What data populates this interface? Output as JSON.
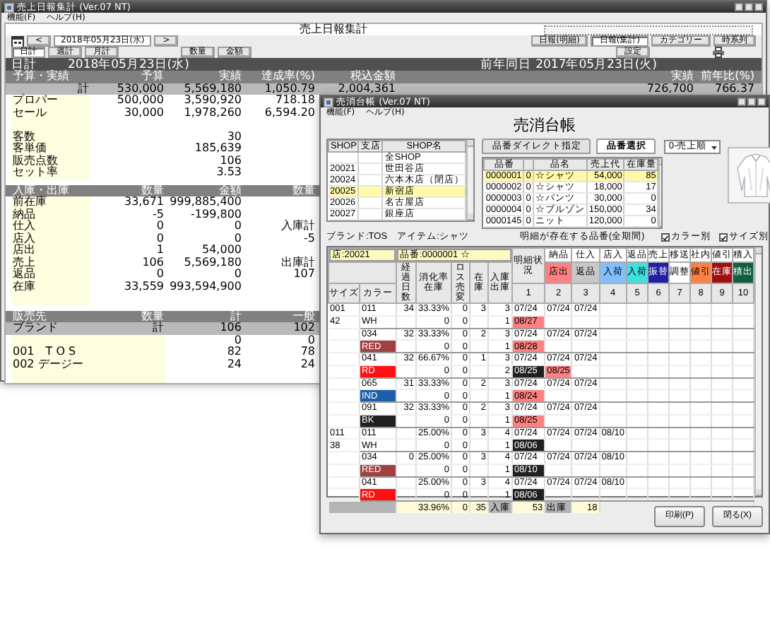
{
  "back_window": {
    "title": "売上日報集計 (Ver.07 NT)",
    "menu": [
      "機能(F)",
      "ヘルプ(H)"
    ],
    "heading": "売上日報集計",
    "date_field": "2018年05月23日(水)",
    "nav_prev": "<",
    "nav_next": ">",
    "view_tabs": [
      {
        "label": "日計",
        "selected": true
      },
      {
        "label": "週計",
        "selected": false
      },
      {
        "label": "月計",
        "selected": false
      }
    ],
    "unit_buttons": [
      "数量",
      "金額"
    ],
    "report_buttons": [
      {
        "label": "日報(明細)",
        "selected": false
      },
      {
        "label": "日報(集計)",
        "selected": true
      },
      {
        "label": "カテゴリー",
        "selected": false
      },
      {
        "label": "時系列",
        "selected": false
      }
    ],
    "settings_button": "設定",
    "date_bar": {
      "label": "日計",
      "date": "2018年05月23日(水)",
      "prev_label": "前年同日",
      "prev_date": "2017年05月23日(火)"
    },
    "sections": [
      {
        "kind": "summary",
        "columns": [
          "予算・実績",
          "予算",
          "実績",
          "達成率(%)",
          "税込金額",
          null,
          "実績",
          "前年比(%)"
        ],
        "rows": [
          {
            "kind": "total",
            "cells": [
              "計",
              "530,000",
              "5,569,180",
              "1,050.79",
              "2,004,361",
              null,
              "726,700",
              "766.37"
            ]
          },
          {
            "kind": "item",
            "cells": [
              "プロパー",
              "500,000",
              "3,590,920",
              "718.18"
            ]
          },
          {
            "kind": "item",
            "cells": [
              "セール",
              "30,000",
              "1,978,260",
              "6,594.20"
            ]
          },
          {
            "kind": "gap",
            "cells": []
          },
          {
            "kind": "item",
            "cells": [
              "客数",
              null,
              "30"
            ]
          },
          {
            "kind": "item",
            "cells": [
              "客単価",
              null,
              "185,639"
            ]
          },
          {
            "kind": "item",
            "cells": [
              "販売点数",
              null,
              "106"
            ]
          },
          {
            "kind": "item",
            "cells": [
              "セット率",
              null,
              "3.53"
            ]
          }
        ]
      },
      {
        "kind": "summary",
        "columns": [
          "入庫・出庫",
          "数量",
          "金額",
          "数量"
        ],
        "rows": [
          {
            "kind": "item",
            "cells": [
              "前在庫",
              "33,671",
              "999,885,400"
            ]
          },
          {
            "kind": "item",
            "cells": [
              "納品",
              "-5",
              "-199,800"
            ]
          },
          {
            "kind": "item",
            "cells": [
              "仕入",
              "0",
              "0",
              "入庫計"
            ]
          },
          {
            "kind": "item",
            "cells": [
              "店入",
              "0",
              "0",
              "-5"
            ]
          },
          {
            "kind": "item",
            "cells": [
              "店出",
              "1",
              "54,000"
            ]
          },
          {
            "kind": "item",
            "cells": [
              "売上",
              "106",
              "5,569,180",
              "出庫計"
            ]
          },
          {
            "kind": "item",
            "cells": [
              "返品",
              "0",
              "0",
              "107"
            ]
          },
          {
            "kind": "item",
            "cells": [
              "在庫",
              "33,559",
              "993,594,900"
            ]
          },
          {
            "kind": "gap",
            "cells": []
          }
        ]
      },
      {
        "kind": "breakdown",
        "columns": [
          "販売先",
          "数量",
          "計",
          "一般"
        ],
        "rows": [
          {
            "kind": "total",
            "cells": [
              "ブランド",
              "計",
              "106",
              "102"
            ]
          },
          {
            "kind": "item",
            "cells": [
              null,
              null,
              "0",
              "0"
            ]
          },
          {
            "kind": "item",
            "cells": [
              "001　T O S",
              null,
              "82",
              "78"
            ]
          },
          {
            "kind": "item",
            "cells": [
              "002 デージー",
              null,
              "24",
              "24"
            ]
          },
          {
            "kind": "gap",
            "cells": []
          }
        ]
      }
    ]
  },
  "front_window": {
    "title": "売消台帳 (Ver.07 NT)",
    "menu": [
      "機能(F)",
      "ヘルプ(H)"
    ],
    "heading": "売消台帳",
    "shop_table": {
      "columns": [
        "SHOP",
        "支店",
        "SHOP名"
      ],
      "rows": [
        {
          "name": "全SHOP",
          "selected": false
        },
        {
          "shop": "20021",
          "name": "世田谷店",
          "selected": false
        },
        {
          "shop": "20024",
          "name": "六本木店（閉店）",
          "selected": false
        },
        {
          "shop": "20025",
          "name": "新宿店",
          "selected": true
        },
        {
          "shop": "20026",
          "name": "名古屋店",
          "selected": false
        },
        {
          "shop": "20027",
          "name": "銀座店",
          "selected": false
        }
      ]
    },
    "product_tabs": [
      {
        "label": "品番ダイレクト指定",
        "selected": false
      },
      {
        "label": "品番選択",
        "selected": true
      }
    ],
    "sort_select": "0-売上順",
    "product_table": {
      "columns": [
        "品番",
        "",
        "品名",
        "売上代",
        "在庫量"
      ],
      "rows": [
        {
          "cells": [
            "0000001",
            "0",
            "☆シャツ",
            "54,000",
            "85"
          ],
          "selected": true
        },
        {
          "cells": [
            "0000002",
            "0",
            "☆シャツ",
            "18,000",
            "17"
          ],
          "selected": false
        },
        {
          "cells": [
            "0000003",
            "0",
            "☆パンツ",
            "30,000",
            "0"
          ],
          "selected": false
        },
        {
          "cells": [
            "0000004",
            "0",
            "☆ブルゾン",
            "150,000",
            "34"
          ],
          "selected": false
        },
        {
          "cells": [
            "0000145",
            "0",
            "ニット",
            "120,000",
            "0"
          ],
          "selected": false
        }
      ]
    },
    "item_info": "ブランド:TOS　アイテム:シャツ",
    "detail_note": "明細が存在する品番(全期間)",
    "options": [
      {
        "label": "カラー別",
        "checked": true
      },
      {
        "label": "サイズ別",
        "checked": true
      }
    ],
    "grid": {
      "shop_field": "店:20021",
      "item_field": "品番:0000001 ☆",
      "status_label": "明細状況",
      "legend_top": [
        {
          "label": "納品",
          "color": "#ffffff"
        },
        {
          "label": "仕入",
          "color": "#ffffff"
        },
        {
          "label": "店入",
          "color": "#ffffff"
        },
        {
          "label": "返品",
          "color": "#ffffff"
        },
        {
          "label": "売上",
          "color": "#ffffff"
        },
        {
          "label": "移送",
          "color": "#ffffff"
        },
        {
          "label": "社内",
          "color": "#ffffff"
        },
        {
          "label": "値引",
          "color": "#ffffff"
        },
        {
          "label": "積入",
          "color": "#ffffff"
        }
      ],
      "legend_bottom": [
        {
          "label": "店出",
          "color": "#ff8080"
        },
        {
          "label": "返品",
          "color": "#c8c8c8"
        },
        {
          "label": "入荷",
          "color": "#80c0ff"
        },
        {
          "label": "入荷",
          "color": "#40e0e0"
        },
        {
          "label": "振替",
          "color": "#2020a0"
        },
        {
          "label": "調整",
          "color": "#ffffff"
        },
        {
          "label": "値引",
          "color": "#ff8040"
        },
        {
          "label": "在庫",
          "color": "#a01010"
        },
        {
          "label": "積出",
          "color": "#106040"
        }
      ],
      "columns": [
        "サイズ",
        "カラー",
        "経過日数",
        "消化率在庫",
        "ロス売変",
        "在庫",
        "入庫出庫"
      ],
      "periods": [
        "1",
        "2",
        "3",
        "4",
        "5",
        "6",
        "7",
        "8",
        "9",
        "10"
      ],
      "groups": [
        {
          "size": [
            "001",
            "42"
          ],
          "code": "011",
          "name": "WH",
          "color": "#ffffff",
          "rows": [
            {
              "cells": [
                "34",
                "33.33%",
                "0",
                "3",
                "3"
              ],
              "dates": [
                {
                  "text": "07/24"
                },
                {
                  "text": "07/24"
                },
                {
                  "text": "07/24"
                }
              ]
            },
            {
              "cells": [
                null,
                "0",
                "0",
                null,
                "1"
              ],
              "dates": [
                {
                  "text": "08/27",
                  "color": "#ff8080"
                }
              ]
            }
          ]
        },
        {
          "code": "034",
          "name": "RED",
          "color": "#a04040",
          "rows": [
            {
              "cells": [
                "32",
                "33.33%",
                "0",
                "2",
                "3"
              ],
              "dates": [
                {
                  "text": "07/24"
                },
                {
                  "text": "07/24"
                },
                {
                  "text": "07/24"
                }
              ]
            },
            {
              "cells": [
                null,
                "0",
                "0",
                null,
                "1"
              ],
              "dates": [
                {
                  "text": "08/28",
                  "color": "#ff8080"
                }
              ]
            }
          ]
        },
        {
          "code": "041",
          "name": "RD",
          "color": "#ff1010",
          "rows": [
            {
              "cells": [
                "32",
                "66.67%",
                "0",
                "1",
                "3"
              ],
              "dates": [
                {
                  "text": "07/24"
                },
                {
                  "text": "07/24"
                },
                {
                  "text": "07/24"
                }
              ]
            },
            {
              "cells": [
                null,
                "0",
                "0",
                null,
                "2"
              ],
              "dates": [
                {
                  "text": "08/25",
                  "color": "#202020"
                },
                {
                  "text": "08/25",
                  "color": "#ff8080"
                }
              ]
            }
          ]
        },
        {
          "code": "065",
          "name": "IND",
          "color": "#1d5ea8",
          "rows": [
            {
              "cells": [
                "31",
                "33.33%",
                "0",
                "2",
                "3"
              ],
              "dates": [
                {
                  "text": "07/24"
                },
                {
                  "text": "07/24"
                },
                {
                  "text": "07/24"
                }
              ]
            },
            {
              "cells": [
                null,
                "0",
                "0",
                null,
                "1"
              ],
              "dates": [
                {
                  "text": "08/24",
                  "color": "#ff8080"
                }
              ]
            }
          ]
        },
        {
          "code": "091",
          "name": "BK",
          "color": "#202020",
          "rows": [
            {
              "cells": [
                "32",
                "33.33%",
                "0",
                "2",
                "3"
              ],
              "dates": [
                {
                  "text": "07/24"
                },
                {
                  "text": "07/24"
                },
                {
                  "text": "07/24"
                }
              ]
            },
            {
              "cells": [
                null,
                "0",
                "0",
                null,
                "1"
              ],
              "dates": [
                {
                  "text": "08/25",
                  "color": "#ff8080"
                }
              ]
            }
          ]
        },
        {
          "size": [
            "011",
            "38"
          ],
          "code": "011",
          "name": "WH",
          "color": "#ffffff",
          "rows": [
            {
              "cells": [
                null,
                "25.00%",
                "0",
                "3",
                "4"
              ],
              "dates": [
                {
                  "text": "07/24"
                },
                {
                  "text": "07/24"
                },
                {
                  "text": "07/24"
                },
                {
                  "text": "08/10"
                }
              ]
            },
            {
              "cells": [
                null,
                "0",
                "0",
                null,
                "1"
              ],
              "dates": [
                {
                  "text": "08/06",
                  "color": "#202020"
                }
              ]
            }
          ]
        },
        {
          "code": "034",
          "name": "RED",
          "color": "#a04040",
          "rows": [
            {
              "cells": [
                "0",
                "25.00%",
                "0",
                "3",
                "4"
              ],
              "dates": [
                {
                  "text": "07/24"
                },
                {
                  "text": "07/24"
                },
                {
                  "text": "07/24"
                },
                {
                  "text": "08/10"
                }
              ]
            },
            {
              "cells": [
                null,
                "0",
                "0",
                null,
                "1"
              ],
              "dates": [
                {
                  "text": "08/10",
                  "color": "#202020"
                }
              ]
            }
          ]
        },
        {
          "code": "041",
          "name": "RD",
          "color": "#ff1010",
          "rows": [
            {
              "cells": [
                null,
                "25.00%",
                "0",
                "3",
                "4"
              ],
              "dates": [
                {
                  "text": "07/24"
                },
                {
                  "text": "07/24"
                },
                {
                  "text": "07/24"
                },
                {
                  "text": "08/10"
                }
              ]
            },
            {
              "cells": [
                null,
                "0",
                "0",
                null,
                "1"
              ],
              "dates": [
                {
                  "text": "08/06",
                  "color": "#202020"
                }
              ]
            }
          ]
        }
      ],
      "totals": {
        "rate": "33.96%",
        "loss": "0",
        "stock": "35",
        "in_label": "入庫",
        "in": "53",
        "out_label": "出庫",
        "out": "18"
      }
    },
    "buttons": [
      "印刷(P)",
      "閉る(X)"
    ]
  }
}
